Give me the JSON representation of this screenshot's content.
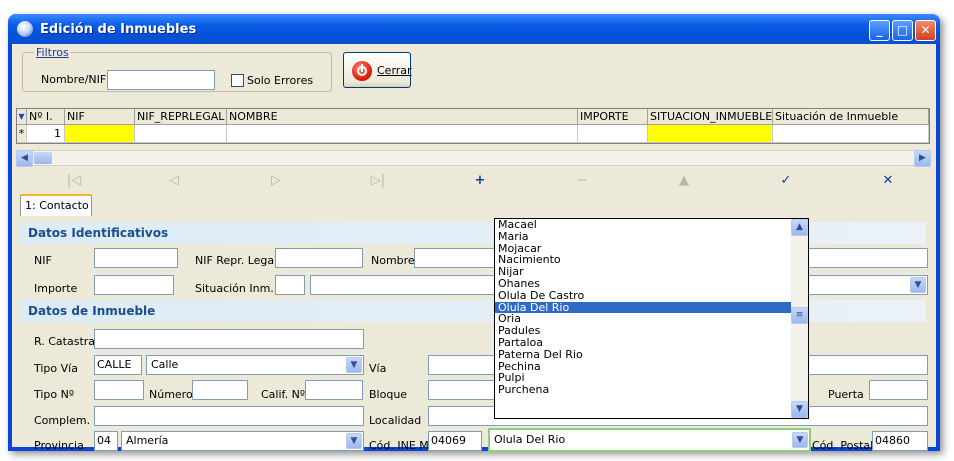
{
  "window": {
    "title": "Edición de Inmuebles",
    "buttons": {
      "minimize": "_",
      "maximize": "□",
      "close": "✕"
    }
  },
  "filters": {
    "legend": "Filtros",
    "nif_label": "Nombre/NIF",
    "nif_value": "",
    "solo_errores_label": "Solo Errores",
    "solo_errores_checked": false,
    "close_button": "Cerrar"
  },
  "grid": {
    "columns": [
      "Nº I.",
      "NIF",
      "NIF_REPRLEGAL",
      "NOMBRE",
      "IMPORTE",
      "SITUACION_INMUEBLE",
      "Situación de Inmueble"
    ],
    "new_row_marker": "*",
    "row": {
      "num": "1",
      "nif": "",
      "nif_reprlegal": "",
      "nombre": "",
      "importe": "",
      "situacion": "",
      "situacion_desc": ""
    },
    "highlight_color": "#ffff00"
  },
  "navigator": [
    "|◁",
    "◁",
    "▷",
    "▷|",
    "+",
    "−",
    "▲",
    "✓",
    "✕"
  ],
  "tabs": [
    "1: Contacto"
  ],
  "section_identificativos": {
    "title": "Datos Identificativos",
    "nif": "NIF",
    "nif_repr": "NIF Repr. Legal",
    "nombre": "Nombre",
    "importe": "Importe",
    "situacion": "Situación Inm."
  },
  "section_inmueble": {
    "title": "Datos de Inmueble",
    "ref_catastral": "R. Catastral",
    "tipo_via": "Tipo Vía",
    "tipo_via_code": "CALLE",
    "tipo_via_value": "Calle",
    "via": "Vía",
    "tipo_num": "Tipo Nº",
    "numero": "Número",
    "calif": "Calif. Nº",
    "bloque": "Bloque",
    "puerta": "Puerta",
    "complem": "Complem.",
    "localidad": "Localidad",
    "provincia": "Provincia",
    "provincia_code": "04",
    "provincia_value": "Almería",
    "cod_ine": "Cód. INE M.",
    "cod_ine_value": "04069",
    "municipio_value": "Olula Del Rio",
    "cod_postal": "Cód. Postal",
    "cod_postal_value": "04860"
  },
  "dropdown_list": [
    "Macael",
    "Maria",
    "Mojacar",
    "Nacimiento",
    "Nijar",
    "Ohanes",
    "Olula De Castro",
    "Olula Del Rio",
    "Oria",
    "Padules",
    "Partaloa",
    "Paterna Del Rio",
    "Pechina",
    "Pulpi",
    "Purchena"
  ],
  "dropdown_selected": "Olula Del Rio",
  "colors": {
    "titlebar": "#0651d8",
    "section_text": "#1b4f8a",
    "selection": "#316ac5"
  }
}
